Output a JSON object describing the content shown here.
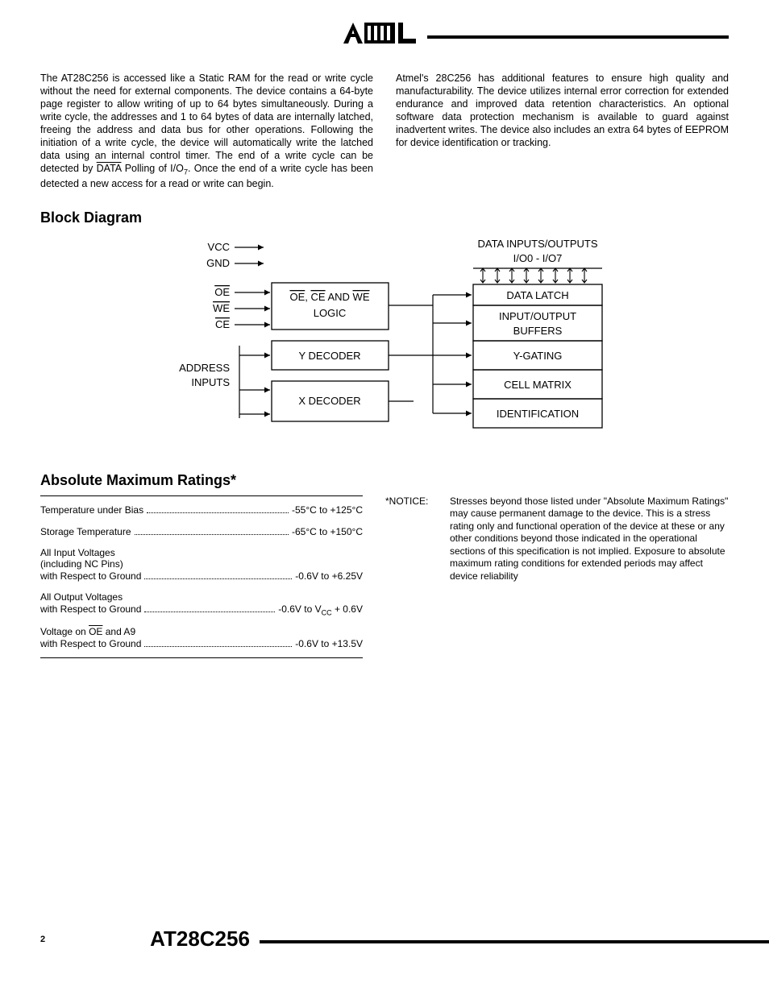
{
  "header": {
    "logo_text": "ATMEL"
  },
  "intro": {
    "left_part1": "The AT28C256 is accessed like a Static RAM for the read or write cycle without the need for external components. The device contains a 64-byte page register to allow writing of up to 64 bytes simultaneously. During a write cycle, the addresses and 1 to 64 bytes of data are internally latched, freeing the address and data bus for other operations. Following the initiation of a write cycle, the device will automatically write the latched data using an internal control timer. The end of a write cycle can be detected by ",
    "left_overline": "DATA",
    "left_part2": " Polling of I/O",
    "left_sub": "7",
    "left_part3": ". Once the end of a write cycle has been detected a new access for a read or write can begin.",
    "right": "Atmel's 28C256 has additional features to ensure high quality and manufacturability. The device utilizes internal error correction for extended endurance and improved data retention characteristics. An optional software data protection mechanism is available to guard against inadvertent writes. The device also includes an extra 64 bytes of EEPROM for device identification or tracking."
  },
  "sections": {
    "block_diagram": "Block Diagram",
    "abs_max": "Absolute Maximum Ratings*"
  },
  "diagram": {
    "vcc": "VCC",
    "gnd": "GND",
    "oe": "OE",
    "we": "WE",
    "ce": "CE",
    "address": "ADDRESS",
    "inputs": "INPUTS",
    "logic1a": "OE",
    "logic1b": "CE",
    "logic_and": " AND ",
    "logic1c": "WE",
    "logic2": "LOGIC",
    "ydec": "Y DECODER",
    "xdec": "X DECODER",
    "data_io": "DATA  INPUTS/OUTPUTS",
    "io_range": "I/O0  -  I/O7",
    "data_latch": "DATA  LATCH",
    "io_buf1": "INPUT/OUTPUT",
    "io_buf2": "BUFFERS",
    "ygating": "Y-GATING",
    "cell": "CELL  MATRIX",
    "ident": "IDENTIFICATION"
  },
  "ratings": {
    "r1_label": "Temperature under Bias",
    "r1_value": "-55°C to +125°C",
    "r2_label": "Storage Temperature",
    "r2_value": "-65°C to +150°C",
    "r3_l1": "All Input Voltages",
    "r3_l2": "(including NC Pins)",
    "r3_l3": "with Respect to Ground",
    "r3_value": "-0.6V to +6.25V",
    "r4_l1": "All Output Voltages",
    "r4_l2": "with Respect to Ground",
    "r4_value_pre": "-0.6V to V",
    "r4_value_sub": "CC",
    "r4_value_post": " + 0.6V",
    "r5_l1_pre": "Voltage on ",
    "r5_l1_ov": "OE",
    "r5_l1_post": " and A9",
    "r5_l2": "with Respect to Ground",
    "r5_value": "-0.6V to +13.5V"
  },
  "notice": {
    "label": "*NOTICE:",
    "text": "Stresses beyond those listed under \"Absolute Maximum Ratings\" may cause permanent damage to the device. This is a stress rating only and functional operation of the device at these or any other conditions beyond those indicated in the operational sections of this specification is not implied. Exposure to absolute maximum rating conditions for extended periods may affect device reliability"
  },
  "footer": {
    "page": "2",
    "title": "AT28C256"
  }
}
